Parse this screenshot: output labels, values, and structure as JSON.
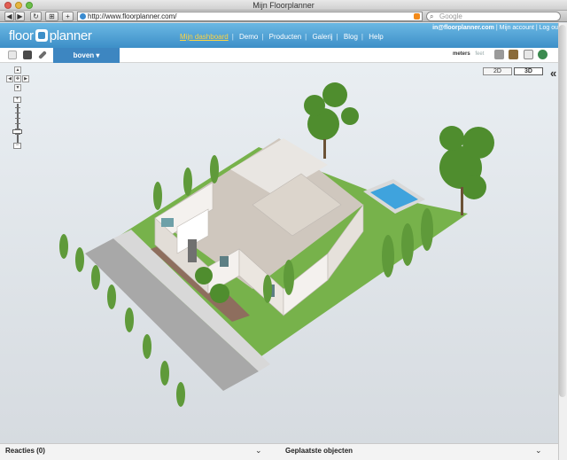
{
  "browser": {
    "window_title": "Mijn Floorplanner",
    "nav": {
      "back": "◀",
      "forward": "▶",
      "reload": "↻",
      "tabs": "⊞",
      "new_tab": "+"
    },
    "url": "http://www.floorplanner.com/",
    "search_placeholder": "Google"
  },
  "site": {
    "logo_left": "floor",
    "logo_right": "planner",
    "nav_items": [
      "Mijn dashboard",
      "Demo",
      "Producten",
      "Galerij",
      "Blog",
      "Help"
    ],
    "active_nav": "Mijn dashboard",
    "user_email": "in@floorplanner.com",
    "account_link": "Mijn account",
    "logout_link": "Log out"
  },
  "app": {
    "floor_tab": "boven ▾",
    "units_active": "meters",
    "units_inactive": "feet",
    "view_2d": "2D",
    "view_3d": "3D",
    "selected_view": "3D",
    "collapse": "«",
    "zoom_plus": "+",
    "zoom_minus": "−",
    "pan_up": "▲",
    "pan_down": "▼",
    "pan_left": "◀",
    "pan_right": "▶",
    "pan_center": "✥"
  },
  "panels": {
    "reactions": "Reacties (0)",
    "placed_objects": "Geplaatste objecten",
    "chevron": "⌄"
  },
  "colors": {
    "header_blue": "#3d8fc8",
    "tab_blue": "#3d86c1",
    "grass": "#76b34c",
    "road": "#a9a9a9",
    "wall": "#f4f1ee",
    "pool": "#3fa3dd"
  }
}
